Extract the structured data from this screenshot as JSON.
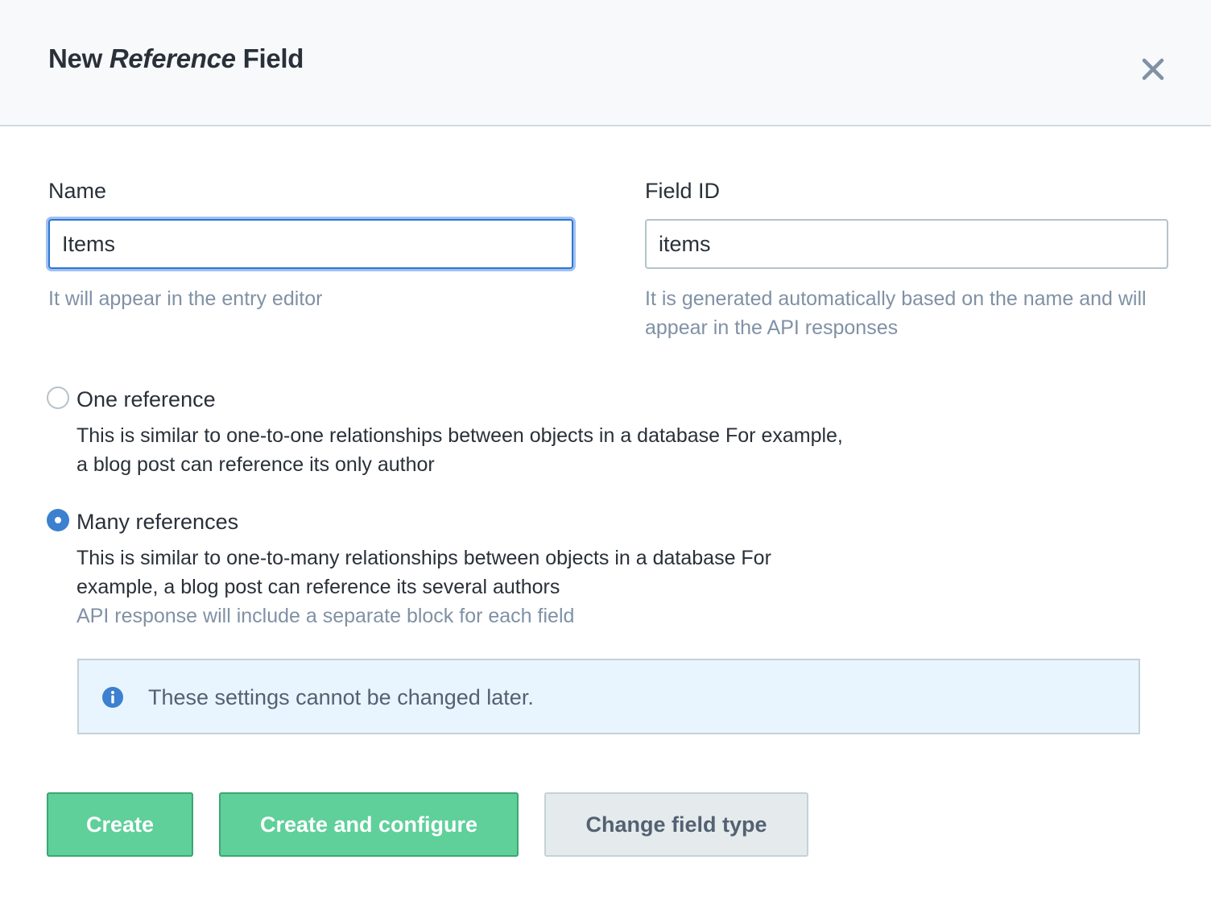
{
  "header": {
    "title_prefix": "New",
    "title_type": "Reference",
    "title_suffix": "Field",
    "close_icon": "close-icon"
  },
  "form": {
    "name": {
      "label": "Name",
      "value": "Items",
      "hint": "It will appear in the entry editor"
    },
    "field_id": {
      "label": "Field ID",
      "value": "items",
      "hint_line1": "It is generated automatically based on the name and will",
      "hint_line2": "appear in the API responses"
    }
  },
  "options": {
    "selected": "many",
    "one": {
      "title": "One reference",
      "desc_line1": "This is similar to one-to-one relationships between objects in a database For example,",
      "desc_line2": "a blog post can reference its only author"
    },
    "many": {
      "title": "Many references",
      "desc_line1": "This is similar to one-to-many relationships between objects in a database For",
      "desc_line2": "example, a blog post can reference its several authors",
      "note": "API response will include a separate block for each field"
    }
  },
  "notice": {
    "icon": "info-icon",
    "text": "These settings cannot be changed later."
  },
  "buttons": {
    "create": "Create",
    "create_configure": "Create and configure",
    "change_type": "Change field type"
  },
  "colors": {
    "primary_button": "#5fd09a",
    "focus_ring": "#2e75d4",
    "radio_checked": "#3c80cf",
    "notice_bg": "#e8f5ff"
  }
}
